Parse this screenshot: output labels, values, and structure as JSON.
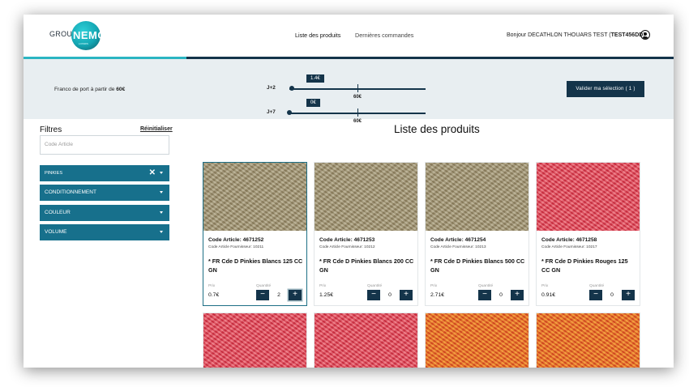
{
  "header": {
    "logo_groupe": "GROUPE",
    "logo_nemo": "NEMO",
    "logo_sub": "LOISIRS",
    "nav": [
      "Liste des produits",
      "Dernières commandes"
    ],
    "greeting_prefix": "Bonjour DECATHLON THOUARS TEST (",
    "greeting_code": "TEST456DD",
    "greeting_suffix": ")"
  },
  "progress": {
    "fill_percent": 25
  },
  "shipping": {
    "franco_prefix": "Franco de port à partir de ",
    "franco_amount": "60€",
    "rows": [
      {
        "label": "J+2",
        "current": "1.4€",
        "threshold": "60€",
        "fraction": 0.02
      },
      {
        "label": "J+7",
        "current": "0€",
        "threshold": "60€",
        "fraction": 0.0
      }
    ],
    "validate_label": "Valider ma sélection ( 1 )"
  },
  "sidebar": {
    "title": "Filtres",
    "reset": "Réinitialiser",
    "code_placeholder": "Code Article",
    "filters": [
      "PINKIES",
      "CONDITIONNEMENT",
      "COULEUR",
      "VOLUME"
    ]
  },
  "main": {
    "title": "Liste des produits",
    "price_label": "Prix",
    "qty_label": "Quantité",
    "products": [
      {
        "code": "Code Article: 4671252",
        "code_fournisseur": "Code Article Fournisseur: 10211",
        "name": "* FR Cde D Pinkies Blancs 125 CC GN",
        "price": "0.7€",
        "qty": "2"
      },
      {
        "code": "Code Article: 4671253",
        "code_fournisseur": "Code Article Fournisseur: 10212",
        "name": "* FR Cde D Pinkies Blancs 200 CC GN",
        "price": "1.25€",
        "qty": "0"
      },
      {
        "code": "Code Article: 4671254",
        "code_fournisseur": "Code Article Fournisseur: 10213",
        "name": "* FR Cde D Pinkies Blancs 500 CC GN",
        "price": "2.71€",
        "qty": "0"
      },
      {
        "code": "Code Article: 4671258",
        "code_fournisseur": "Code Article Fournisseur: 10217",
        "name": "* FR Cde D Pinkies Rouges 125 CC GN",
        "price": "0.91€",
        "qty": "0"
      }
    ]
  },
  "colors": {
    "navy": "#14344a",
    "teal": "#2bb5c2",
    "filter_blue": "#17708c"
  }
}
